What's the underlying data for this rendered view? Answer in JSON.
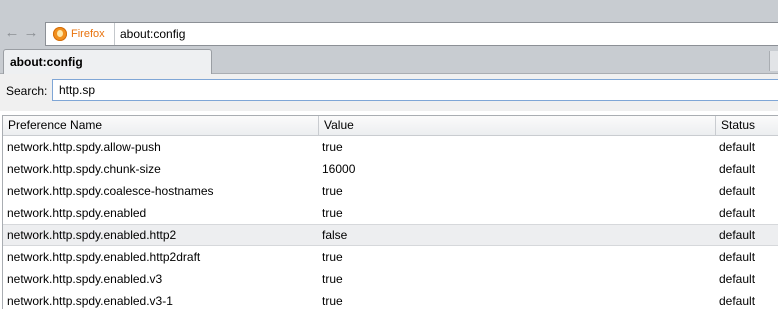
{
  "navbar": {
    "back_icon": "back-arrow-icon",
    "forward_icon": "forward-arrow-icon",
    "identity_label": "Firefox",
    "url": "about:config"
  },
  "tabs": [
    {
      "label": "about:config",
      "selected": true
    }
  ],
  "search": {
    "label": "Search:",
    "value": "http.sp"
  },
  "table": {
    "columns": [
      "Preference Name",
      "Value",
      "Status"
    ],
    "rows": [
      {
        "name": "network.http.spdy.allow-push",
        "value": "true",
        "status": "default"
      },
      {
        "name": "network.http.spdy.chunk-size",
        "value": "16000",
        "status": "default"
      },
      {
        "name": "network.http.spdy.coalesce-hostnames",
        "value": "true",
        "status": "default"
      },
      {
        "name": "network.http.spdy.enabled",
        "value": "true",
        "status": "default"
      },
      {
        "name": "network.http.spdy.enabled.http2",
        "value": "false",
        "status": "default"
      },
      {
        "name": "network.http.spdy.enabled.http2draft",
        "value": "true",
        "status": "default"
      },
      {
        "name": "network.http.spdy.enabled.v3",
        "value": "true",
        "status": "default"
      },
      {
        "name": "network.http.spdy.enabled.v3-1",
        "value": "true",
        "status": "default"
      }
    ],
    "selected_row": 4
  },
  "colors": {
    "chrome": "#c8ccd1",
    "firefox_orange": "#e8730e",
    "selected_row": "#edeef0"
  }
}
